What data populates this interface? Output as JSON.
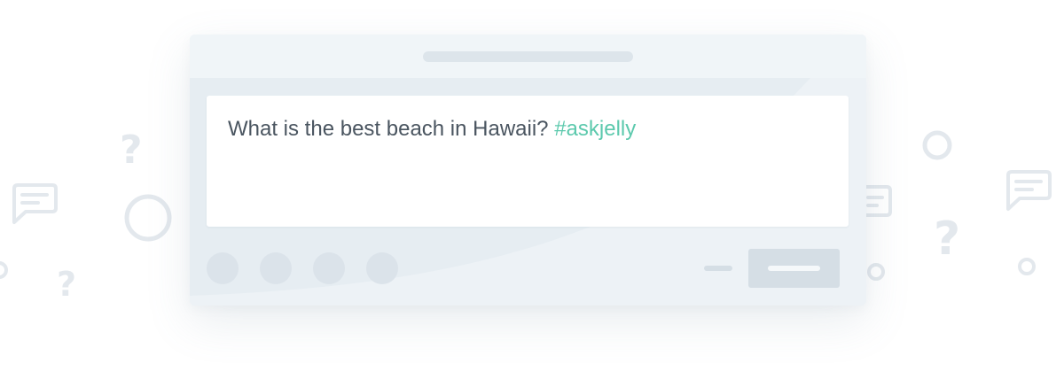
{
  "composer": {
    "question": "What is the best beach in Hawaii? ",
    "hashtag": "#askjelly"
  },
  "decorations": {
    "question_mark": "?"
  },
  "colors": {
    "hashtag": "#5cc9ad",
    "text": "#4a5560",
    "window_bg": "#e6edf2",
    "titlebar_bg": "#f0f5f8",
    "placeholder": "#dbe3ea",
    "decoration": "#e3e8ed"
  },
  "icons": [
    "question-mark-icon",
    "chat-bubble-icon",
    "circle-icon"
  ]
}
